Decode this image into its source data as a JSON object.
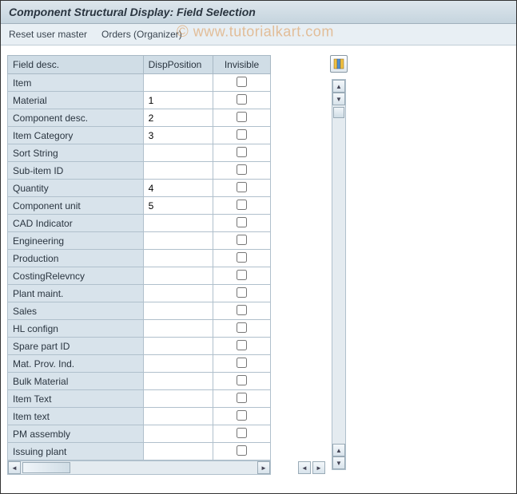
{
  "title": "Component Structural Display: Field Selection",
  "toolbar": {
    "reset": "Reset user master",
    "orders": "Orders (Organizer)"
  },
  "watermark": "www.tutorialkart.com",
  "columns": {
    "desc": "Field desc.",
    "pos": "DispPosition",
    "inv": "Invisible"
  },
  "rows": [
    {
      "label": "Item",
      "pos": ""
    },
    {
      "label": "Material",
      "pos": "1"
    },
    {
      "label": "Component desc.",
      "pos": "2"
    },
    {
      "label": "Item Category",
      "pos": "3"
    },
    {
      "label": "Sort String",
      "pos": ""
    },
    {
      "label": "Sub-item ID",
      "pos": ""
    },
    {
      "label": "Quantity",
      "pos": "4"
    },
    {
      "label": "Component unit",
      "pos": "5"
    },
    {
      "label": "CAD Indicator",
      "pos": ""
    },
    {
      "label": "Engineering",
      "pos": ""
    },
    {
      "label": "Production",
      "pos": ""
    },
    {
      "label": "CostingRelevncy",
      "pos": ""
    },
    {
      "label": "Plant maint.",
      "pos": ""
    },
    {
      "label": "Sales",
      "pos": ""
    },
    {
      "label": "HL confign",
      "pos": ""
    },
    {
      "label": "Spare part ID",
      "pos": ""
    },
    {
      "label": "Mat. Prov. Ind.",
      "pos": ""
    },
    {
      "label": "Bulk Material",
      "pos": ""
    },
    {
      "label": "Item Text",
      "pos": ""
    },
    {
      "label": "Item text",
      "pos": ""
    },
    {
      "label": "PM assembly",
      "pos": ""
    },
    {
      "label": "Issuing plant",
      "pos": ""
    }
  ]
}
